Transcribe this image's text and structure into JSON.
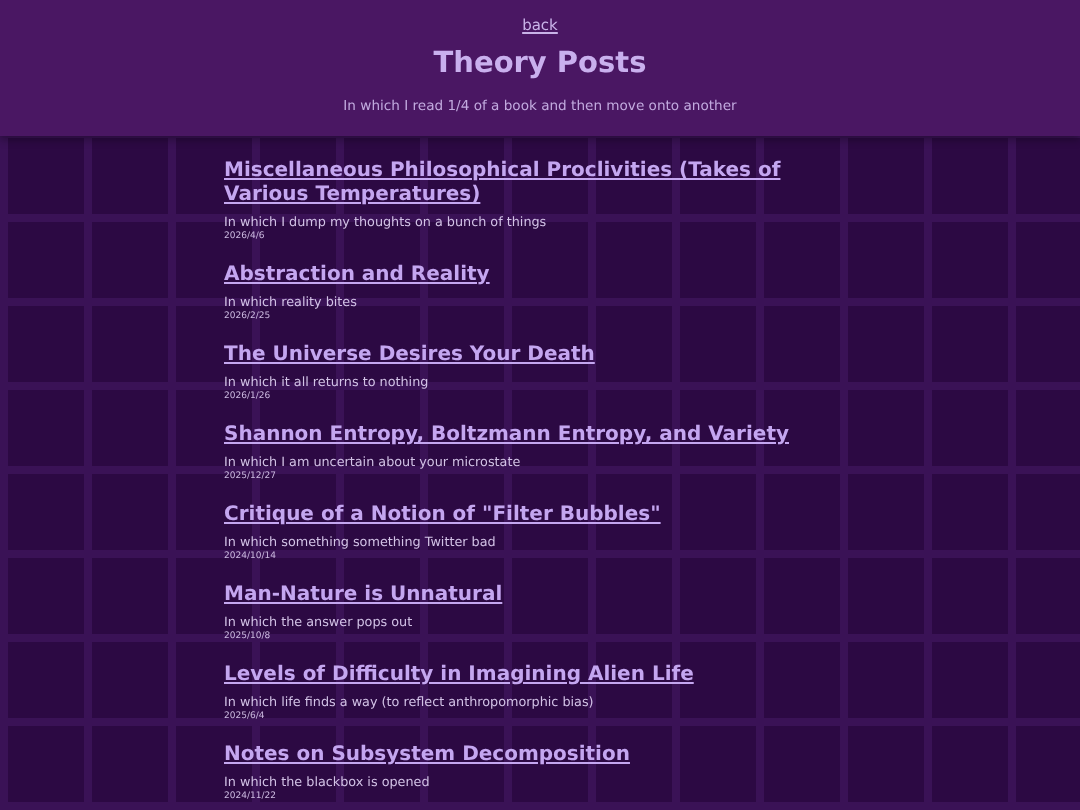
{
  "header": {
    "back_link": "back",
    "title": "Theory Posts",
    "subtitle": "In which I read 1/4 of a book and then move onto another"
  },
  "posts": [
    {
      "title": "Miscellaneous Philosophical Proclivities (Takes of Various Temperatures)",
      "summary": "In which I dump my thoughts on a bunch of things",
      "date": "2026/4/6"
    },
    {
      "title": "Abstraction and Reality",
      "summary": "In which reality bites",
      "date": "2026/2/25"
    },
    {
      "title": "The Universe Desires Your Death",
      "summary": "In which it all returns to nothing",
      "date": "2026/1/26"
    },
    {
      "title": "Shannon Entropy, Boltzmann Entropy, and Variety",
      "summary": "In which I am uncertain about your microstate",
      "date": "2025/12/27"
    },
    {
      "title": "Critique of a Notion of \"Filter Bubbles\"",
      "summary": "In which something something Twitter bad",
      "date": "2024/10/14"
    },
    {
      "title": "Man-Nature is Unnatural",
      "summary": "In which the answer pops out",
      "date": "2025/10/8"
    },
    {
      "title": "Levels of Difficulty in Imagining Alien Life",
      "summary": "In which life finds a way (to reflect anthropomorphic bias)",
      "date": "2025/6/4"
    },
    {
      "title": "Notes on Subsystem Decomposition",
      "summary": "In which the blackbox is opened",
      "date": "2024/11/22"
    }
  ]
}
